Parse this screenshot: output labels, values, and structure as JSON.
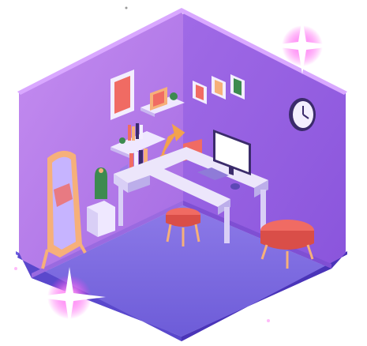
{
  "scene": {
    "subject": "isometric-room",
    "objects": [
      "back-wall-left",
      "back-wall-right",
      "floor",
      "framed-picture-large",
      "framed-picture-small",
      "wall-shelf",
      "picture-frames-trio",
      "wall-clock",
      "bookshelf-shelf",
      "books",
      "desk-lamp",
      "corner-desk",
      "monitor",
      "keyboard",
      "mouse",
      "cactus-plant",
      "floor-mirror",
      "small-stool",
      "ottoman",
      "sparkle-top-right",
      "sparkle-bottom-left"
    ],
    "colors": {
      "wall_left": "#b27be6",
      "wall_right": "#9b62e0",
      "floor": "#7d6be0",
      "edge_dark": "#5a3fc9",
      "accent_coral": "#f06b63",
      "desk_top": "#ece6fb",
      "desk_side": "#cfc4f2",
      "screen": "#ffffff",
      "sparkle": "#ffffff",
      "sparkle_glow": "#ff3df0"
    }
  }
}
